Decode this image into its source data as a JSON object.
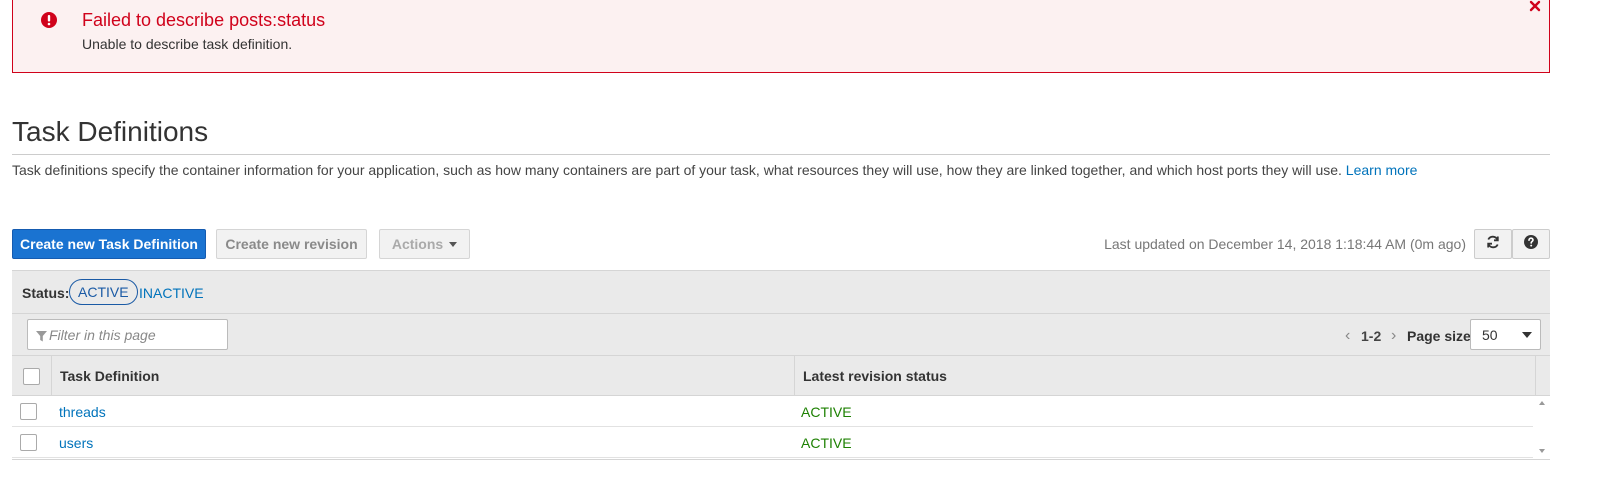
{
  "alert": {
    "title": "Failed to describe posts:status",
    "message": "Unable to describe task definition.",
    "color": "#d0021b"
  },
  "page": {
    "title": "Task Definitions",
    "description": "Task definitions specify the container information for your application, such as how many containers are part of your task, what resources they will use, how they are linked together, and which host ports they will use.",
    "learn_more": "Learn more"
  },
  "toolbar": {
    "create_label": "Create new Task Definition",
    "revision_label": "Create new revision",
    "actions_label": "Actions",
    "last_updated": "Last updated on December 14, 2018 1:18:44 AM (0m ago)",
    "refresh_icon": "refresh-icon",
    "help_icon": "help-icon"
  },
  "status_filter": {
    "label": "Status:",
    "active": "ACTIVE",
    "inactive": "INACTIVE"
  },
  "filter": {
    "placeholder": "Filter in this page",
    "icon": "filter-icon"
  },
  "pagination": {
    "range": "1-2",
    "page_size_label": "Page size",
    "page_size": "50"
  },
  "table": {
    "columns": [
      "Task Definition",
      "Latest revision status"
    ],
    "rows": [
      {
        "name": "threads",
        "status": "ACTIVE"
      },
      {
        "name": "users",
        "status": "ACTIVE"
      }
    ]
  },
  "colors": {
    "primary": "#1a73d1",
    "link": "#0073bb",
    "status_active": "#1d8102",
    "error": "#d0021b"
  }
}
